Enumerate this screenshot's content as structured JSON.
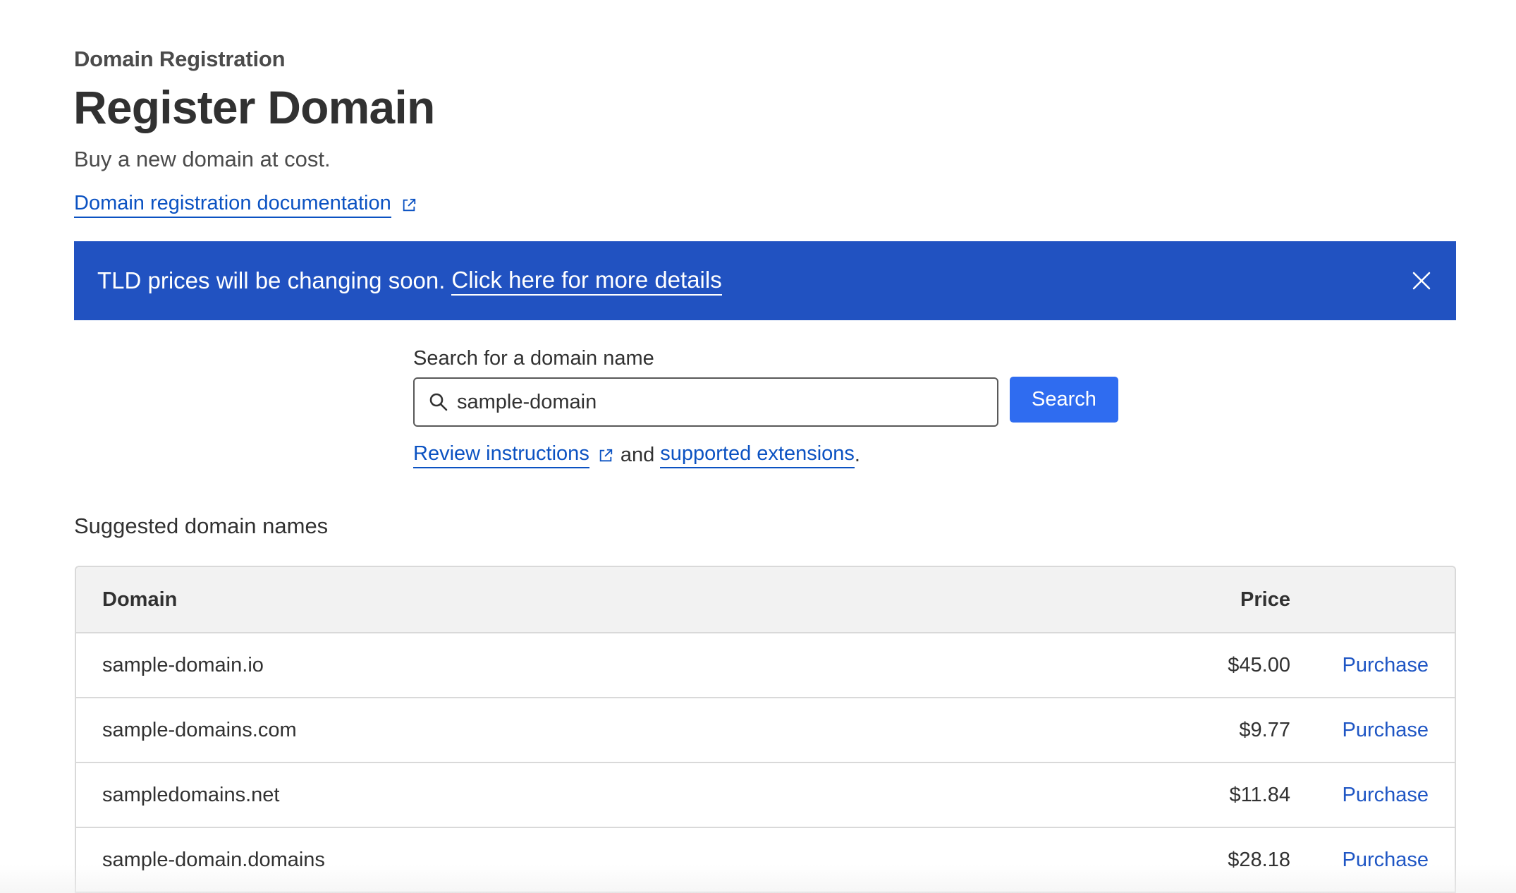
{
  "header": {
    "breadcrumb": "Domain Registration",
    "title": "Register Domain",
    "subtitle": "Buy a new domain at cost.",
    "doc_link": "Domain registration documentation"
  },
  "banner": {
    "text": "TLD prices will be changing soon.",
    "link": "Click here for more details",
    "close_icon": "close-icon",
    "color": "#2152c1"
  },
  "search": {
    "label": "Search for a domain name",
    "value": "sample-domain",
    "button_label": "Search",
    "button_color": "#2f6cf0",
    "helper": {
      "link1": "Review instructions",
      "and": "and",
      "link2": "supported extensions",
      "period": "."
    }
  },
  "suggestions": {
    "title": "Suggested domain names",
    "columns": {
      "domain": "Domain",
      "price": "Price"
    },
    "rows": [
      {
        "domain": "sample-domain.io",
        "price": "$45.00",
        "action": "Purchase"
      },
      {
        "domain": "sample-domains.com",
        "price": "$9.77",
        "action": "Purchase"
      },
      {
        "domain": "sampledomains.net",
        "price": "$11.84",
        "action": "Purchase"
      },
      {
        "domain": "sample-domain.domains",
        "price": "$28.18",
        "action": "Purchase"
      }
    ]
  }
}
